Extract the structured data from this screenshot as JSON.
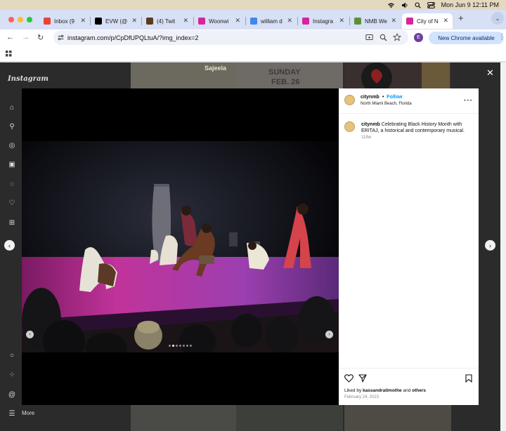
{
  "menubar": {
    "datetime": "Mon Jun 9  12:11 PM"
  },
  "tabs": [
    {
      "label": "Inbox (9",
      "icon": "gmail-icon",
      "color": "#ea4335"
    },
    {
      "label": "EVW (@",
      "icon": "x-icon",
      "color": "#000000"
    },
    {
      "label": "(4) Twit",
      "icon": "twitch-icon",
      "color": "#5a3b1c"
    },
    {
      "label": "Woonwi",
      "icon": "instagram-icon",
      "color": "#d6249f"
    },
    {
      "label": "william d",
      "icon": "google-icon",
      "color": "#4285f4"
    },
    {
      "label": "Instagra",
      "icon": "instagram-icon",
      "color": "#d6249f"
    },
    {
      "label": "NMB We",
      "icon": "nmb-icon",
      "color": "#5c8f3a"
    },
    {
      "label": "City of N",
      "icon": "instagram-icon",
      "color": "#d6249f"
    }
  ],
  "toolbar": {
    "url": "instagram.com/p/CpDfUPQLtuA/?img_index=2",
    "new_chrome_label": "New Chrome available",
    "profile_initial": "E"
  },
  "sidebar": {
    "logo": "Instagram",
    "more_label": "More"
  },
  "post": {
    "username": "citynmb",
    "separator": "•",
    "follow_label": "Follow",
    "location": "North Miami Beach, Florida",
    "caption_user": "citynmb",
    "caption_text": "Celebrating Black History Month with ERITAJ, a historical and contemporary musical.",
    "time_ago": "119w",
    "liked_by_prefix": "Liked by",
    "liked_by_user": "kassandratimothe",
    "liked_by_and": "and",
    "liked_by_others": "others",
    "date": "February 24, 2023"
  },
  "background": {
    "tile1_text": "Sajeela",
    "tile2_text": "SUNDAY",
    "tile3_text": "FEB. 26"
  },
  "carousel": {
    "dot_count": 7,
    "active_dot": 1
  },
  "colors": {
    "instagram_blue": "#0095f6",
    "chrome_pill": "#d3e3fd",
    "stage_magenta": "#c1339a"
  }
}
